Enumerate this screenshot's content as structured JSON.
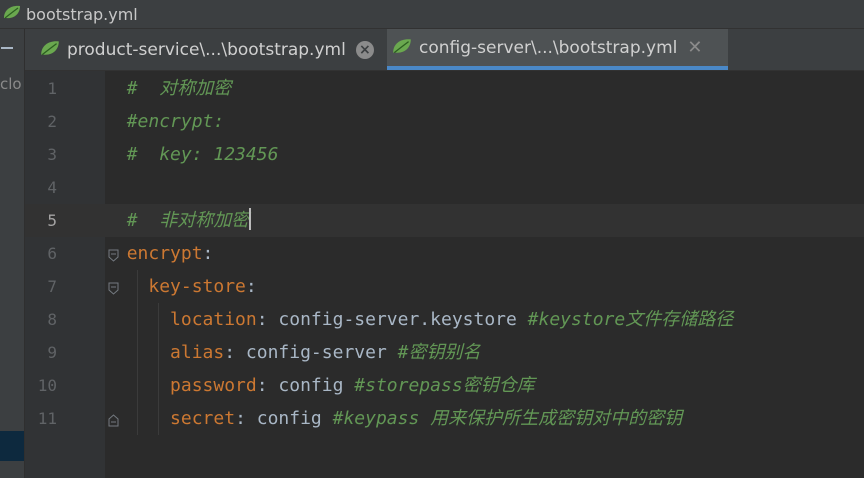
{
  "window": {
    "title": "bootstrap.yml"
  },
  "left_panel": {
    "truncated_label": "clo"
  },
  "tabs": [
    {
      "label": "product-service\\...\\bootstrap.yml",
      "active": false
    },
    {
      "label": "config-server\\...\\bootstrap.yml",
      "active": true
    }
  ],
  "editor": {
    "current_line": 5,
    "lines": [
      {
        "number": "1",
        "indent": "",
        "comment": "#  对称加密"
      },
      {
        "number": "2",
        "indent": "",
        "comment": "#encrypt:"
      },
      {
        "number": "3",
        "indent": "",
        "comment": "#  key: 123456"
      },
      {
        "number": "4",
        "indent": ""
      },
      {
        "number": "5",
        "indent": "",
        "comment": "#  非对称加密"
      },
      {
        "number": "6",
        "indent": "",
        "key": "encrypt",
        "sep": ":"
      },
      {
        "number": "7",
        "indent": "  ",
        "key": "key-store",
        "sep": ":"
      },
      {
        "number": "8",
        "indent": "    ",
        "key": "location",
        "sep": ": ",
        "value": "config-server.keystore ",
        "comment": "#keystore文件存储路径"
      },
      {
        "number": "9",
        "indent": "    ",
        "key": "alias",
        "sep": ": ",
        "value": "config-server ",
        "comment": "#密钥别名"
      },
      {
        "number": "10",
        "indent": "    ",
        "key": "password",
        "sep": ": ",
        "value": "config ",
        "comment": "#storepass密钥仓库"
      },
      {
        "number": "11",
        "indent": "    ",
        "key": "secret",
        "sep": ": ",
        "value": "config ",
        "comment": "#keypass 用来保护所生成密钥对中的密钥"
      }
    ]
  },
  "colors": {
    "background": "#2b2b2b",
    "gutter": "#313335",
    "key": "#cc7832",
    "text": "#a9b7c6",
    "comment": "#629755",
    "active_tab_underline": "#4a88c7"
  },
  "icons": {
    "file_type": "spring-leaf-icon",
    "fold": "fold-marker-icon",
    "close": "close-icon"
  }
}
